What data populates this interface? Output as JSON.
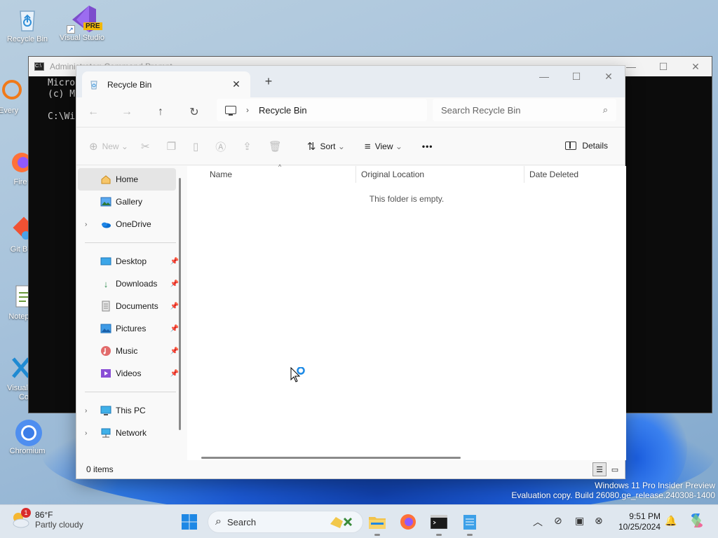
{
  "desktop": {
    "icons": [
      {
        "label": "Recycle Bin"
      },
      {
        "label": "Visual Studio",
        "badge": "PRE"
      },
      {
        "label": "Every"
      },
      {
        "label": "Fire"
      },
      {
        "label": "Git B"
      },
      {
        "label": "Notep"
      },
      {
        "label": "Visual"
      },
      {
        "label": "Co"
      },
      {
        "label": "Chromium"
      }
    ]
  },
  "console": {
    "title": "Administrator: Command Prompt",
    "lines": [
      "Microsoft",
      "(c) Micro",
      "C:\\Windo"
    ],
    "icon": "console-icon"
  },
  "explorer": {
    "tab_title": "Recycle Bin",
    "tab_close": "✕",
    "new_tab": "+",
    "caption": {
      "minimize": "—",
      "maximize": "☐",
      "close": "✕"
    },
    "breadcrumb": "Recycle Bin",
    "search_placeholder": "Search Recycle Bin",
    "commands": {
      "new": "New",
      "sort": "Sort",
      "view": "View",
      "more": "•••",
      "details": "Details"
    },
    "nav": {
      "home": "Home",
      "gallery": "Gallery",
      "onedrive": "OneDrive",
      "desktop": "Desktop",
      "downloads": "Downloads",
      "documents": "Documents",
      "pictures": "Pictures",
      "music": "Music",
      "videos": "Videos",
      "thispc": "This PC",
      "network": "Network"
    },
    "columns": {
      "name": "Name",
      "location": "Original Location",
      "date": "Date Deleted"
    },
    "empty_text": "This folder is empty.",
    "status": "0 items"
  },
  "watermark": {
    "line1": "Windows 11 Pro Insider Preview",
    "line2": "Evaluation copy. Build 26080.ge_release.240308-1400"
  },
  "taskbar": {
    "weather_temp": "86°F",
    "weather_desc": "Partly cloudy",
    "weather_badge": "1",
    "search_label": "Search",
    "time": "9:51 PM",
    "date": "10/25/2024"
  },
  "colors": {
    "accent": "#0067c0",
    "console_bg": "#0c0c0c",
    "taskbar_bg": "#dfe7ef"
  }
}
